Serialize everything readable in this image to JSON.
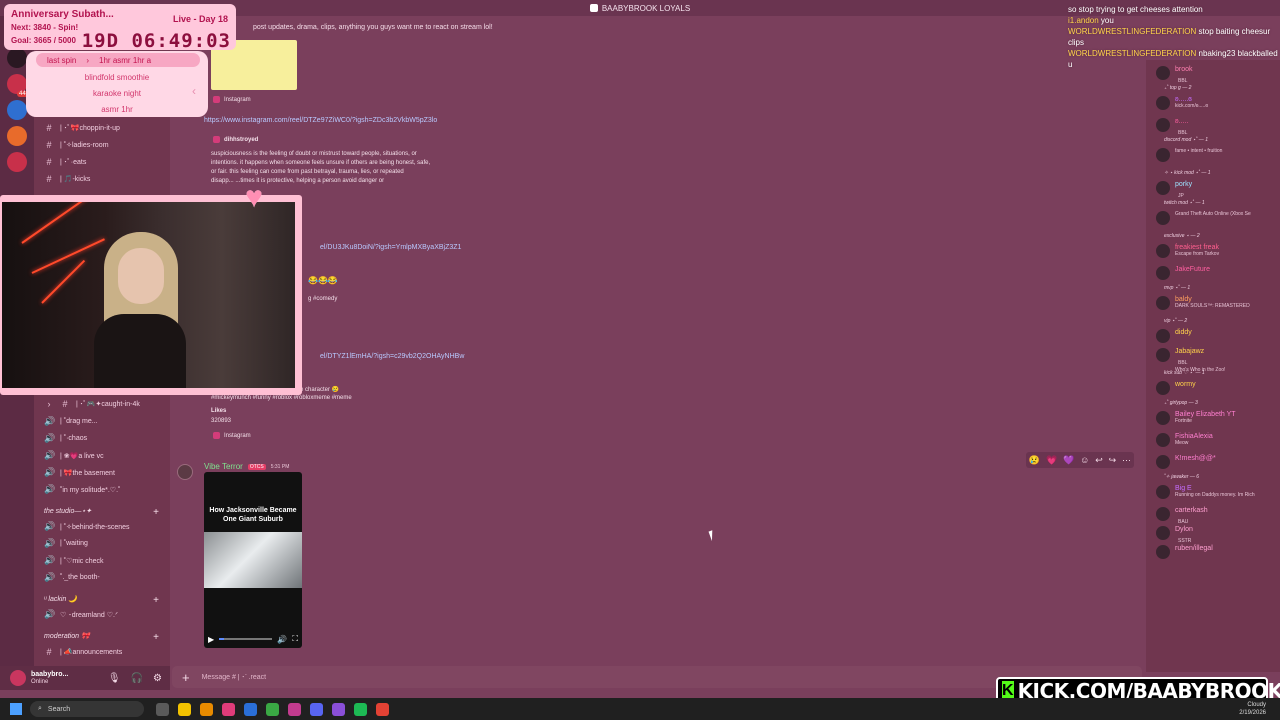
{
  "window": {
    "title": "BAABYBROOK LOYALS"
  },
  "subathon": {
    "title": "Anniversary Subath...",
    "live": "Live - Day 18",
    "next": "Next: 3840 - Spin!",
    "goal": "Goal: 3665 / 5000",
    "timer": "19D 06:49:03"
  },
  "spin": {
    "header_left": "last spin",
    "header_right": "1hr asmr 1hr a",
    "items": [
      "blindfold smoothie",
      "karaoke night",
      "asmr 1hr"
    ]
  },
  "channels": {
    "top": [
      {
        "label": "| ･ﾟ🎀choppin-it-up"
      },
      {
        "label": "| ˚✧ladies-room"
      },
      {
        "label": "| ･ﾟ·eats"
      },
      {
        "label": "| 🎵-kicks"
      },
      {
        "label": "| ･ﾟ🎮✦caught-in-4k"
      }
    ],
    "voice": [
      {
        "label": "| ˚drag me..."
      },
      {
        "label": "| ˚·chaos"
      },
      {
        "label": "| ❀💗a live vc"
      },
      {
        "label": "| 🎀the basement"
      },
      {
        "label": "˚in my solitude*.♡.˚"
      }
    ],
    "cat_studio": "the studio—⋆✦",
    "studio": [
      {
        "label": "| ˚✧behind-the-scenes"
      },
      {
        "label": "| ˚waiting"
      },
      {
        "label": "| ˚♡mic check"
      },
      {
        "label": "˚._the booth-"
      }
    ],
    "cat_lackin": "ᵘ lackin 🌙",
    "lackin": [
      {
        "label": "♡ ･dreamland ♡.ᐟ"
      }
    ],
    "cat_mod": "moderation 🎀",
    "mod": [
      {
        "label": "| 📣announcements"
      }
    ]
  },
  "user_panel": {
    "name": "baabybro...",
    "status": "Online"
  },
  "chat": {
    "topic": "post updates, drama, clips, anything you guys want me to react on stream lol!",
    "instagram": "Instagram",
    "link1": "https://www.instagram.com/reel/DTZe97ZiWC0/?igsh=ZDc3b2VkbW5pZ3lo",
    "poster": "dihhstroyed",
    "body1": "suspiciousness is the feeling of doubt or mistrust toward people, situations, or",
    "body2": "intentions. it happens when someone feels unsure if others are being honest, safe,",
    "body3": "or fair. this feeling can come from past betrayal, trauma, lies, or repeated",
    "body4": "disapp...                    ...times it is protective, helping a person avoid danger or",
    "link2": "el/DU3JKu8DoiN/?igsh=YmlpMXByaXBjZ3Z1",
    "emoji_line": "😂😂😂",
    "comedy": "g #comedy",
    "link3": "el/DTYZ1lEmHA/?igsh=c29vb2Q2OHAyNHBw",
    "character": "e character 😢",
    "hashtags": "#mickeymunch #funny #roblox #robloxmeme #meme",
    "likes_label": "Likes",
    "likes": "320893",
    "author": "Vibe Terror",
    "author_tag": "OTCS",
    "time": "5:31 PM",
    "video_caption": "How Jacksonville Became One Giant Suburb",
    "composer_placeholder": "Message # | ･ﾟ.react"
  },
  "video": {
    "progress": 0.1
  },
  "reactions": [
    "😢",
    "💗",
    "💜",
    "☺",
    "↩",
    "↪",
    "⋯"
  ],
  "members": [
    {
      "name": "brook",
      "badge": "BBL",
      "color": "#ff7fb0"
    },
    {
      "role": "₊˚ top g — 2"
    },
    {
      "name": "ʚ.....ɞ",
      "sub": "kick.com/ʚ.....ɞ",
      "color": "#c56dff"
    },
    {
      "name": "ʚ.....",
      "badge": "BBL",
      "color": "#ff5fa0"
    },
    {
      "role": "discord mod ⋆˚ — 1"
    },
    {
      "name": "",
      "sub": "fame • intent • fruition",
      "color": "#7f5fff"
    },
    {
      "role": "✧ ⋆ kick mod ⋆˚ — 1"
    },
    {
      "name": "porky",
      "badge": "JP",
      "color": "#9de3ff"
    },
    {
      "role": "twitch mod ⋆˚ — 1"
    },
    {
      "name": "",
      "sub": "Grand Theft Auto Online (Xbox Se",
      "color": "#c56dff"
    },
    {
      "role": "exclusive ⋆ — 2"
    },
    {
      "name": "freakiest freak",
      "sub": "Escape from Tarkov",
      "color": "#ff5f8f"
    },
    {
      "name": "JakeFuture",
      "sub": "",
      "color": "#ff5fa0"
    },
    {
      "role": "mvp ⋆˚ — 1"
    },
    {
      "name": "baldy",
      "sub": "DARK SOULS™: REMASTERED",
      "color": "#ff9f5f"
    },
    {
      "role": "vip ⋆˚ — 2"
    },
    {
      "name": "diddy",
      "color": "#ffd24a"
    },
    {
      "name": "Jabajawz",
      "badge": "BBL",
      "sub": "Who's Who in the Zoo!",
      "color": "#ffd24a"
    },
    {
      "role": "kick sub ♡ ⋆˚ — 1"
    },
    {
      "name": "wormy",
      "color": "#ffd24a"
    },
    {
      "role": "₊˚ girlypop — 3"
    },
    {
      "name": "Bailey Elizabeth YT",
      "sub": "Fortnite",
      "color": "#ff7fd0"
    },
    {
      "name": "FishiaAlexia",
      "sub": "Meow",
      "color": "#ff7fd0"
    },
    {
      "name": "K!mesh@@*",
      "color": "#ff7fd0"
    },
    {
      "role": "˚✧ jawaker — 6"
    },
    {
      "name": "Big E",
      "sub": "Running on Daddys money. Im Rich",
      "color": "#c56dff"
    },
    {
      "name": "carterkash",
      "badge": "BAU",
      "color": "#ff9fd0"
    },
    {
      "name": "Dylon",
      "badge": "SSTR",
      "color": "#ff9fd0"
    },
    {
      "name": "ruben/illegal",
      "color": "#ff9fd0"
    }
  ],
  "overlay_chat": [
    {
      "user": "",
      "text": "so stop trying to get cheeses attention"
    },
    {
      "user": "i1.andon",
      "text": " you"
    },
    {
      "user": "WORLDWRESTLINGFEDERATION",
      "text": " stop baiting cheesur clips"
    },
    {
      "user": "WORLDWRESTLINGFEDERATION",
      "text": " nbaking23 blackballed u"
    }
  ],
  "kick": {
    "url": "KICK.COM/BAABYBROOK"
  },
  "taskbar": {
    "search": "Search",
    "weather": "Cloudy",
    "date": "2/19/2026"
  },
  "colors": {
    "background": "#7a3f5c",
    "accent_pink": "#ffc8dc",
    "kick_green": "#53fc18",
    "link": "#b9c9ff"
  },
  "icons": [
    "hash-icon",
    "speaker-icon",
    "mic-icon",
    "headphones-icon",
    "gear-icon",
    "plus-icon",
    "search-icon",
    "play-icon",
    "volume-icon",
    "fullscreen-icon",
    "heart-icon"
  ]
}
